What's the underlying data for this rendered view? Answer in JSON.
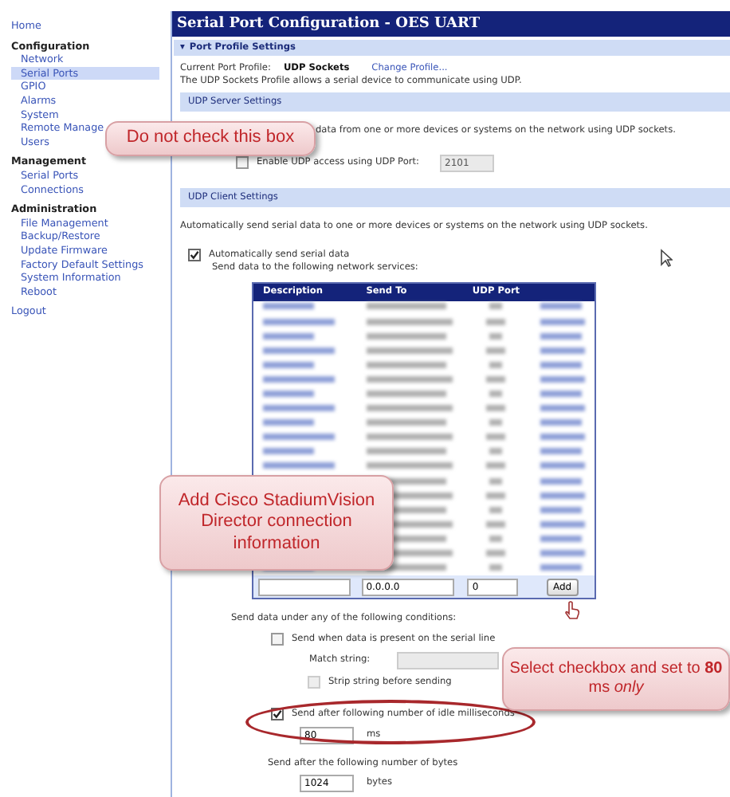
{
  "sidebar": {
    "items": [
      {
        "label": "Home",
        "kind": "link",
        "selected": false
      },
      {
        "label": "Configuration",
        "kind": "heading",
        "selected": false
      },
      {
        "label": "Network",
        "kind": "sub",
        "selected": false
      },
      {
        "label": "Serial Ports",
        "kind": "sub",
        "selected": true
      },
      {
        "label": "GPIO",
        "kind": "sub",
        "selected": false
      },
      {
        "label": "Alarms",
        "kind": "sub",
        "selected": false
      },
      {
        "label": "System",
        "kind": "sub",
        "selected": false
      },
      {
        "label": "Remote Manage",
        "kind": "sub",
        "selected": false
      },
      {
        "label": "Users",
        "kind": "sub",
        "selected": false
      },
      {
        "label": "Management",
        "kind": "heading",
        "selected": false
      },
      {
        "label": "Serial Ports",
        "kind": "sub",
        "selected": false
      },
      {
        "label": "Connections",
        "kind": "sub",
        "selected": false
      },
      {
        "label": "Administration",
        "kind": "heading",
        "selected": false
      },
      {
        "label": "File Management",
        "kind": "sub",
        "selected": false
      },
      {
        "label": "Backup/Restore",
        "kind": "sub",
        "selected": false
      },
      {
        "label": "Update Firmware",
        "kind": "sub",
        "selected": false
      },
      {
        "label": "Factory Default Settings",
        "kind": "sub",
        "selected": false
      },
      {
        "label": "System Information",
        "kind": "sub",
        "selected": false
      },
      {
        "label": "Reboot",
        "kind": "sub",
        "selected": false
      },
      {
        "label": "Logout",
        "kind": "link",
        "selected": false
      }
    ]
  },
  "window": {
    "title": "Serial Port Configuration - OES UART"
  },
  "profile_section": {
    "toggle": "▾",
    "heading": "Port Profile Settings",
    "expanded": true,
    "current_label": "Current Port Profile:",
    "current_value": "UDP Sockets",
    "change_link": "Change Profile...",
    "description": "The UDP Sockets Profile allows a serial device to communicate using UDP."
  },
  "server_section": {
    "heading": "UDP Server Settings",
    "description": "data from one or more devices or systems on the network using UDP sockets.",
    "enable": {
      "label": "Enable UDP access using UDP Port:",
      "checked": false
    },
    "port": {
      "value": "2101",
      "disabled": true
    }
  },
  "client_section": {
    "heading": "UDP Client Settings",
    "description": "Automatically send serial data to one or more devices or systems on the network using UDP sockets.",
    "auto_send": {
      "label": "Automatically send serial data",
      "checked": true
    },
    "services_label": "Send data to the following network services:",
    "table": {
      "columns": [
        "Description",
        "Send To",
        "UDP Port"
      ],
      "rows": [
        {
          "kind": "blurred"
        },
        {
          "kind": "blurred"
        },
        {
          "kind": "blurred"
        },
        {
          "kind": "blurred"
        },
        {
          "kind": "blurred"
        },
        {
          "kind": "blurred"
        },
        {
          "kind": "blurred"
        },
        {
          "kind": "blurred"
        },
        {
          "kind": "blurred"
        },
        {
          "kind": "blurred"
        },
        {
          "kind": "blurred"
        },
        {
          "kind": "blurred"
        },
        {
          "kind": "blurred"
        },
        {
          "kind": "blurred"
        },
        {
          "kind": "blurred"
        },
        {
          "kind": "blurred"
        },
        {
          "kind": "blurred"
        },
        {
          "kind": "blurred"
        },
        {
          "kind": "blurred"
        }
      ],
      "new_row": {
        "send_to": "0.0.0.0",
        "port": "0",
        "button": "Add"
      }
    },
    "conditions_label": "Send data under any of the following conditions:",
    "conditions": [
      {
        "kind": "checkbox",
        "label": "Send when data is present on the serial line",
        "checked": false,
        "disabled": false
      },
      {
        "kind": "field",
        "label": "Match string:",
        "disabled": true
      },
      {
        "kind": "checkbox",
        "label": "Strip string before sending",
        "checked": false,
        "disabled": true
      },
      {
        "kind": "checkbox",
        "label": "Send after following number of idle milliseconds",
        "checked": true,
        "disabled": false,
        "highlighted": true
      },
      {
        "kind": "value",
        "value": "80",
        "unit": "ms"
      },
      {
        "kind": "text",
        "label": "Send after the following number of bytes"
      },
      {
        "kind": "value",
        "value": "1024",
        "unit": "bytes"
      }
    ]
  },
  "callouts": [
    {
      "kind": "server",
      "text": "Do not check this box"
    },
    {
      "kind": "table",
      "text": "Add Cisco StadiumVision Director connection information"
    },
    {
      "kind": "idle",
      "text": "Select checkbox and set to **80** ms *only*"
    }
  ]
}
